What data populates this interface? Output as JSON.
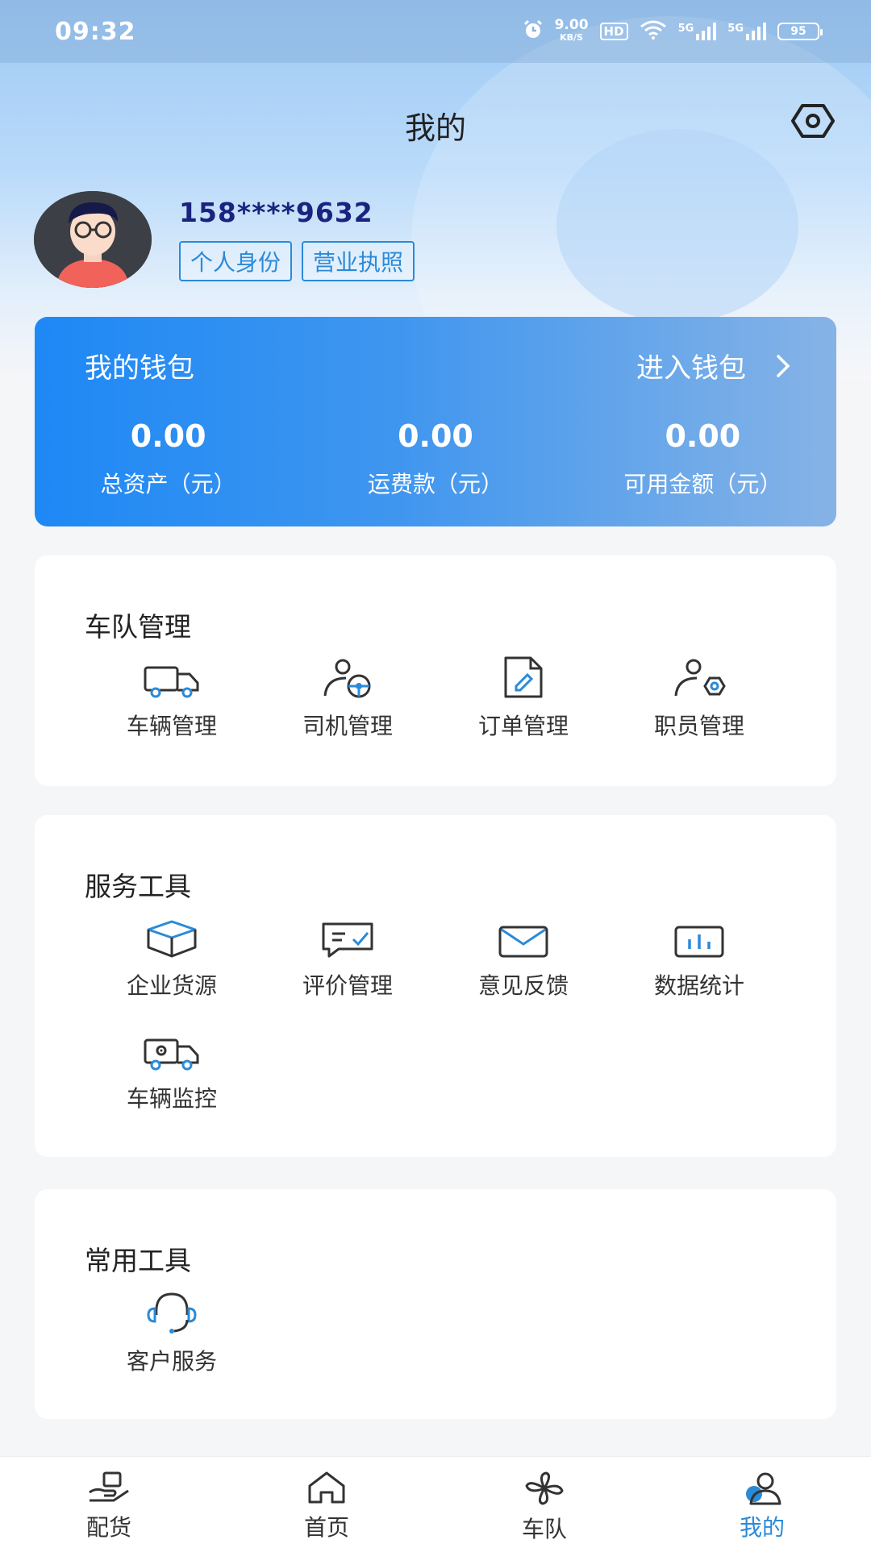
{
  "status_bar": {
    "time": "09:32",
    "speed_value": "9.00",
    "speed_unit": "KB/S",
    "hd_label": "HD",
    "network_1": "5G",
    "network_2": "5G",
    "battery": "95"
  },
  "header": {
    "title": "我的",
    "settings_icon": "settings-hexagon-icon"
  },
  "profile": {
    "phone": "158****9632",
    "tags": [
      "个人身份",
      "营业执照"
    ]
  },
  "wallet": {
    "title": "我的钱包",
    "enter_label": "进入钱包",
    "stats": [
      {
        "value": "0.00",
        "label": "总资产（元）"
      },
      {
        "value": "0.00",
        "label": "运费款（元）"
      },
      {
        "value": "0.00",
        "label": "可用金额（元）"
      }
    ]
  },
  "fleet": {
    "title": "车队管理",
    "items": [
      {
        "label": "车辆管理",
        "icon": "truck-icon"
      },
      {
        "label": "司机管理",
        "icon": "driver-icon"
      },
      {
        "label": "订单管理",
        "icon": "order-document-icon"
      },
      {
        "label": "职员管理",
        "icon": "staff-icon"
      }
    ]
  },
  "service": {
    "title": "服务工具",
    "items": [
      {
        "label": "企业货源",
        "icon": "cargo-box-icon"
      },
      {
        "label": "评价管理",
        "icon": "review-icon"
      },
      {
        "label": "意见反馈",
        "icon": "mail-icon"
      },
      {
        "label": "数据统计",
        "icon": "bar-chart-icon"
      },
      {
        "label": "车辆监控",
        "icon": "truck-monitor-icon"
      }
    ]
  },
  "common": {
    "title": "常用工具",
    "items": [
      {
        "label": "客户服务",
        "icon": "headset-icon"
      }
    ]
  },
  "tabbar": {
    "items": [
      {
        "label": "配货",
        "icon": "hand-box-icon"
      },
      {
        "label": "首页",
        "icon": "home-icon"
      },
      {
        "label": "车队",
        "icon": "pinwheel-icon"
      },
      {
        "label": "我的",
        "icon": "profile-icon",
        "active": true
      }
    ],
    "active_color": "#2b8ad8"
  }
}
